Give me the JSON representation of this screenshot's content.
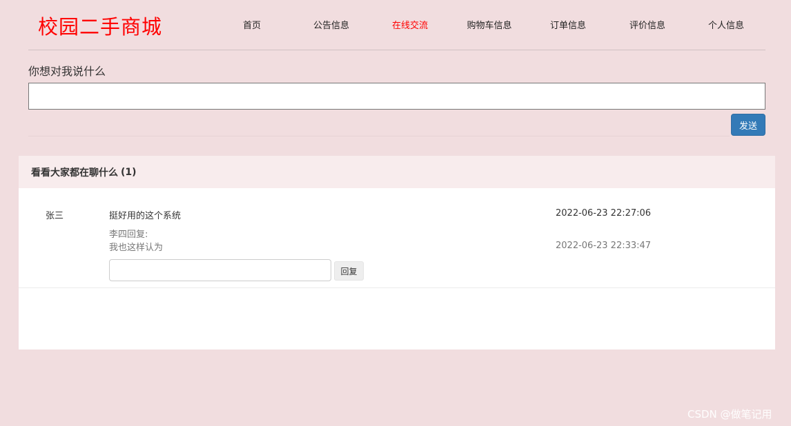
{
  "header": {
    "site_title": "校园二手商城",
    "nav": [
      {
        "label": "首页",
        "active": false
      },
      {
        "label": "公告信息",
        "active": false
      },
      {
        "label": "在线交流",
        "active": true
      },
      {
        "label": "购物车信息",
        "active": false
      },
      {
        "label": "订单信息",
        "active": false
      },
      {
        "label": "评价信息",
        "active": false
      },
      {
        "label": "个人信息",
        "active": false
      }
    ]
  },
  "form": {
    "label": "你想对我说什么",
    "input_value": "",
    "send_label": "发送"
  },
  "panel": {
    "heading": "看看大家都在聊什么",
    "count": "(1)",
    "messages": [
      {
        "user": "张三",
        "text": "挺好用的这个系统",
        "time": "2022-06-23 22:27:06",
        "reply_label": "李四回复:",
        "reply_text": "我也这样认为",
        "reply_time": "2022-06-23 22:33:47",
        "reply_input_value": "",
        "reply_button": "回复"
      }
    ]
  },
  "watermark": "CSDN @做笔记用",
  "colors": {
    "background": "#f1dddf",
    "title_red": "#ff0000",
    "active_nav": "#ff0000",
    "primary_button": "#337ab7"
  }
}
